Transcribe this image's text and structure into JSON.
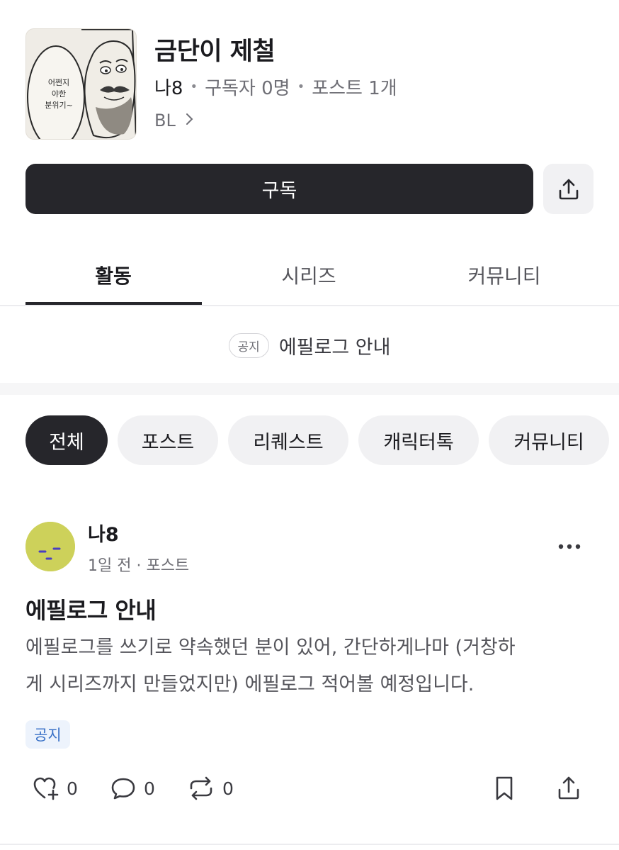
{
  "channel": {
    "title": "금단이 제철",
    "author": "나8",
    "subscribers": "구독자 0명",
    "posts": "포스트 1개",
    "genre": "BL",
    "cover_text": [
      "어쩐지",
      "야한",
      "분위기~"
    ]
  },
  "actions": {
    "subscribe_label": "구독"
  },
  "tabs": [
    {
      "label": "활동",
      "active": true
    },
    {
      "label": "시리즈",
      "active": false
    },
    {
      "label": "커뮤니티",
      "active": false
    }
  ],
  "notice": {
    "badge": "공지",
    "text": "에필로그 안내"
  },
  "filters": [
    {
      "label": "전체",
      "active": true
    },
    {
      "label": "포스트",
      "active": false
    },
    {
      "label": "리퀘스트",
      "active": false
    },
    {
      "label": "캐릭터톡",
      "active": false
    },
    {
      "label": "커뮤니티",
      "active": false
    }
  ],
  "post": {
    "author": "나8",
    "meta": "1일 전 · 포스트",
    "title": "에필로그 안내",
    "body_line1": "에필로그를 쓰기로 약속했던 분이 있어,  간단하게나마 (거창하",
    "body_line2": "게 시리즈까지 만들었지만)  에필로그 적어볼 예정입니다.",
    "tag": "공지",
    "likes": "0",
    "comments": "0",
    "reposts": "0"
  },
  "colors": {
    "primary_dark": "#26262b",
    "chip_bg": "#f1f1f3",
    "tag_blue": "#3a72c7"
  }
}
